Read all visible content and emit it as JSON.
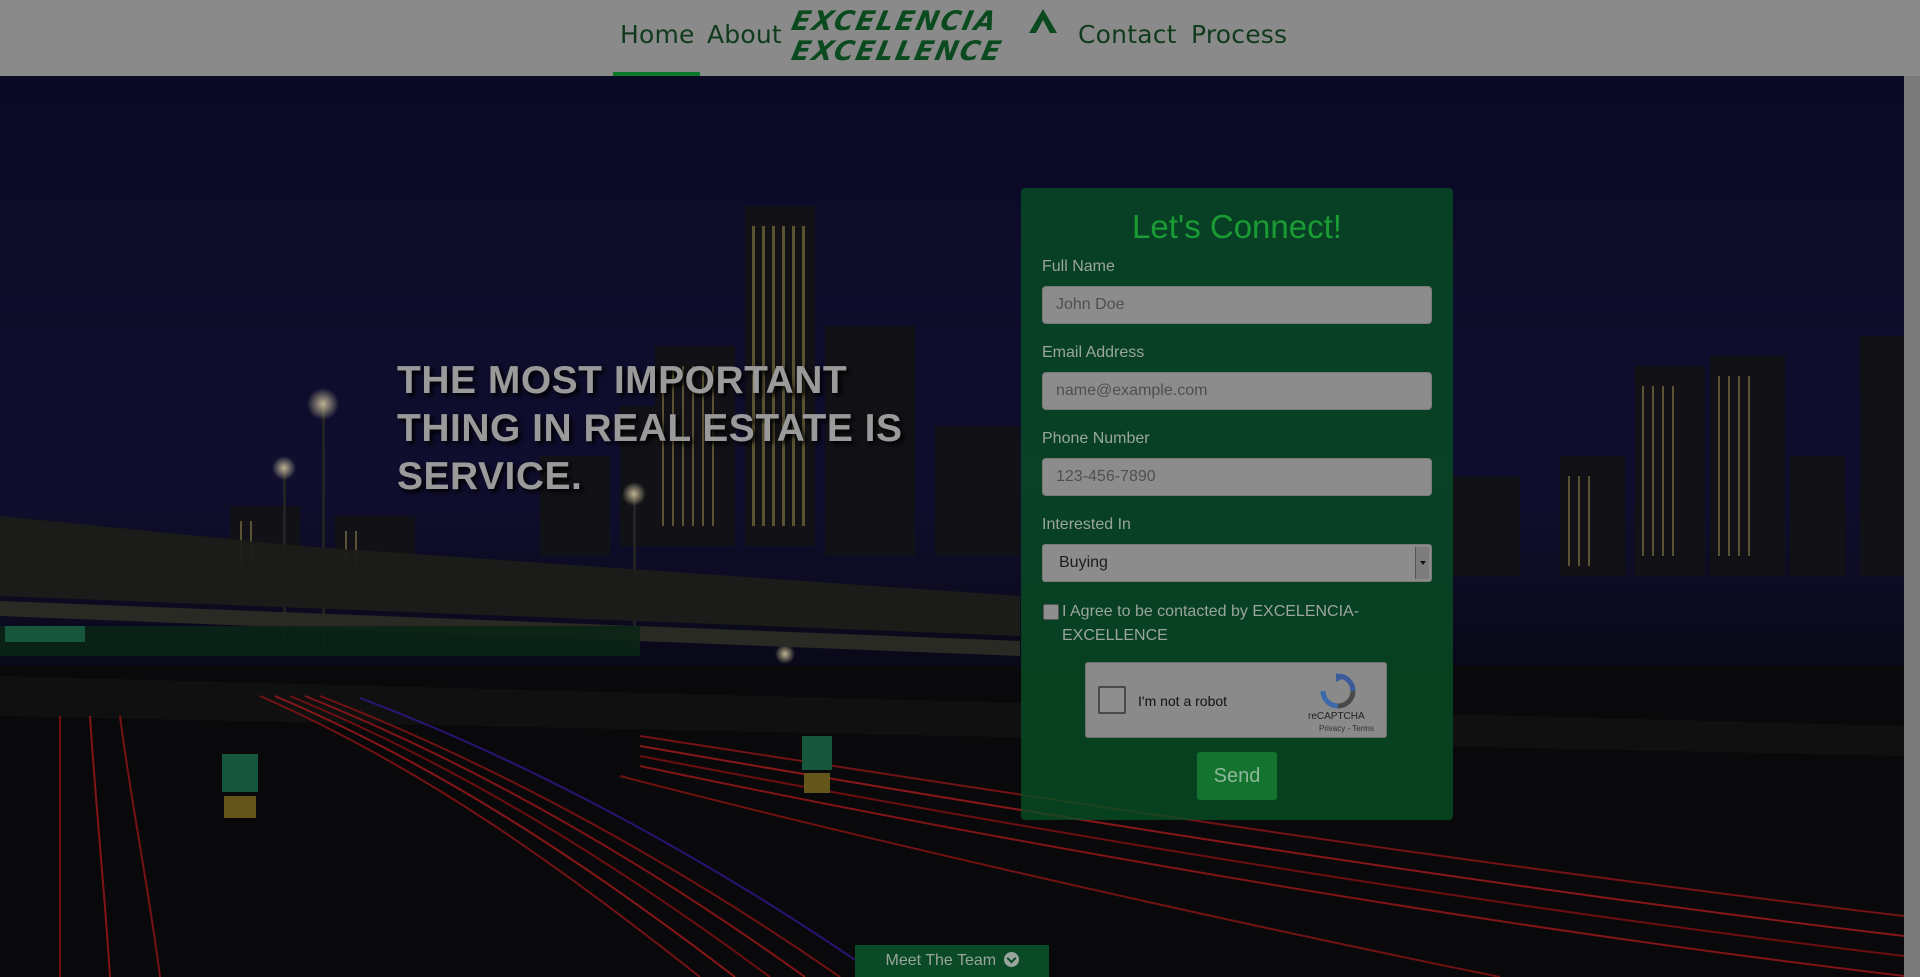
{
  "nav": {
    "home": "Home",
    "about": "About",
    "contact": "Contact",
    "process": "Process",
    "logo_line1": "EXCELENCIA",
    "logo_line2": "EXCELLENCE"
  },
  "hero": {
    "tagline": "THE MOST IMPORTANT THING IN REAL ESTATE IS SERVICE."
  },
  "form": {
    "title": "Let's Connect!",
    "name_label": "Full Name",
    "name_placeholder": "John Doe",
    "email_label": "Email Address",
    "email_placeholder": "name@example.com",
    "phone_label": "Phone Number",
    "phone_placeholder": "123-456-7890",
    "interest_label": "Interested In",
    "interest_value": "Buying",
    "agree_text": "I Agree to be contacted by EXCELENCIA-EXCELLENCE",
    "captcha_label": "I'm not a robot",
    "captcha_brand": "reCAPTCHA",
    "captcha_terms": "Privacy - Terms",
    "send_label": "Send"
  },
  "team_button": "Meet The Team",
  "colors": {
    "brand_green": "#0d7a2a",
    "overlay": "#8a8a8a"
  }
}
